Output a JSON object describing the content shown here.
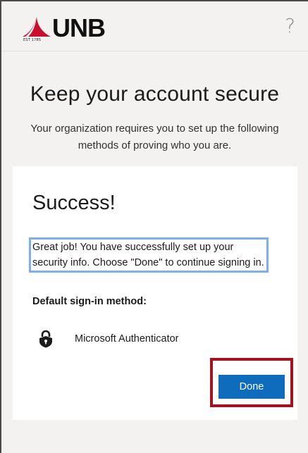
{
  "header": {
    "logo_text": "UNB",
    "logo_est": "EST 1785",
    "help_glyph": "?"
  },
  "page": {
    "title": "Keep your account secure",
    "subtitle": "Your organization requires you to set up the following methods of proving who you are."
  },
  "card": {
    "title": "Success!",
    "message": "Great job! You have successfully set up your security info. Choose \"Done\" to continue signing in.",
    "default_method_label": "Default sign-in method:",
    "method": {
      "name": "Microsoft Authenticator",
      "icon": "lock-icon"
    },
    "done_label": "Done"
  },
  "colors": {
    "accent": "#0f6cbd",
    "highlight": "#a3121e",
    "selection": "#7db0e8",
    "brand_red": "#c8102e"
  }
}
